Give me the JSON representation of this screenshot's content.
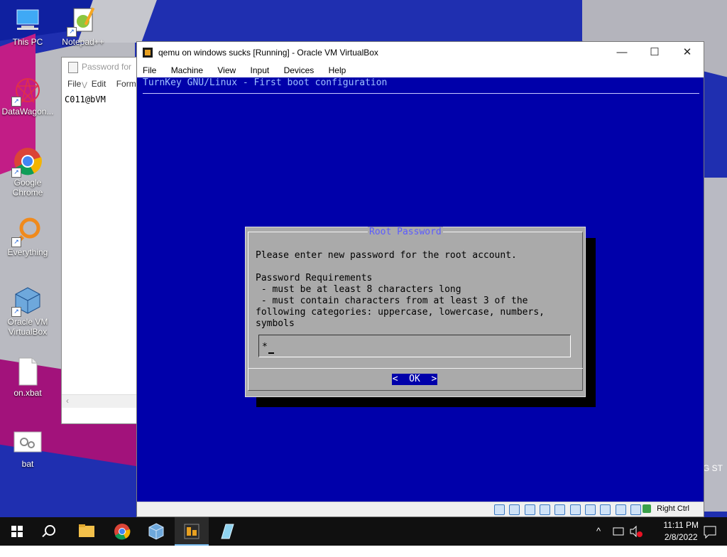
{
  "desktop": {
    "icons": [
      {
        "label": "This PC"
      },
      {
        "label": "Notepad++"
      },
      {
        "label": "DataWagon..."
      },
      {
        "label": "Google Chrome"
      },
      {
        "label": "Everything"
      },
      {
        "label": "Oracle VM VirtualBox"
      },
      {
        "label": "on.xbat"
      },
      {
        "label": "bat"
      }
    ],
    "edge_text": "G ST"
  },
  "notepad": {
    "title": "Password for V",
    "menu": [
      "File",
      "Edit",
      "Forma"
    ],
    "content": "C011@bVM",
    "scroll_arrow": "‹"
  },
  "vbox": {
    "title": "qemu on windows sucks [Running] - Oracle VM VirtualBox",
    "minimize": "—",
    "maximize": "☐",
    "close": "✕",
    "menu": [
      "File",
      "Machine",
      "View",
      "Input",
      "Devices",
      "Help"
    ],
    "status_host_key": "Right Ctrl",
    "colors": {
      "guest_bg": "#0000aa",
      "dialog_bg": "#aaaaaa"
    }
  },
  "guest": {
    "header": "TurnKey GNU/Linux - First boot configuration",
    "dialog": {
      "title": "Root Password",
      "body": "Please enter new password for the root account.\n\nPassword Requirements\n - must be at least 8 characters long\n - must contain characters from at least 3 of the\nfollowing categories: uppercase, lowercase, numbers,\nsymbols",
      "password_value": "*",
      "ok_button": "<  OK  >"
    }
  },
  "taskbar": {
    "clock_time": "11:11 PM",
    "clock_date": "2/8/2022",
    "tray_chevron": "^"
  }
}
